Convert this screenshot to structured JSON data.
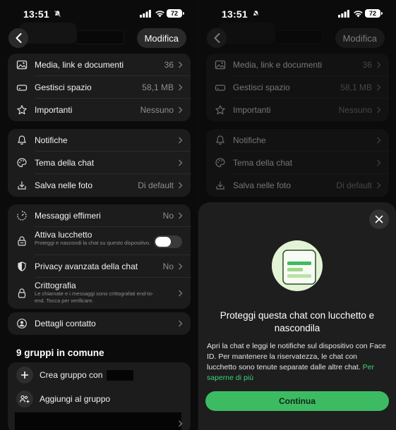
{
  "status": {
    "time": "13:51",
    "battery": "72"
  },
  "header": {
    "modify_label": "Modifica"
  },
  "sections": {
    "media": {
      "label": "Media, link e documenti",
      "value": "36"
    },
    "storage": {
      "label": "Gestisci spazio",
      "value": "58,1 MB"
    },
    "starred": {
      "label": "Importanti",
      "value": "Nessuno"
    },
    "notifications": {
      "label": "Notifiche"
    },
    "theme": {
      "label": "Tema della chat"
    },
    "save_photos": {
      "label": "Salva nelle foto",
      "value": "Di default"
    },
    "disappearing": {
      "label": "Messaggi effimeri",
      "value": "No"
    },
    "chat_lock": {
      "label": "Attiva lucchetto",
      "sub": "Proteggi e nascondi la chat su questo dispositivo.",
      "enabled": false
    },
    "advanced_privacy": {
      "label": "Privacy avanzata della chat",
      "value": "No"
    },
    "encryption": {
      "label": "Crittografia",
      "sub": "Le chiamate e i messaggi sono crittografati end-to-end. Tocca per verificare."
    },
    "contact_details": {
      "label": "Dettagli contatto"
    }
  },
  "groups": {
    "title": "9 gruppi in comune",
    "create_label": "Crea gruppo con",
    "add_label": "Aggiungi al gruppo"
  },
  "sheet": {
    "title": "Proteggi questa chat con lucchetto e nascondila",
    "body": "Apri la chat e leggi le notifiche sul dispositivo con Face ID. Per mantenere la riservatezza, le chat con lucchetto sono tenute separate dalle altre chat.",
    "link": "Per saperne di più",
    "continue_label": "Continua"
  },
  "colors": {
    "accent": "#3dbb63",
    "link": "#3dd17a",
    "card": "#1c1c1c",
    "sheet": "#1e1e1e"
  }
}
